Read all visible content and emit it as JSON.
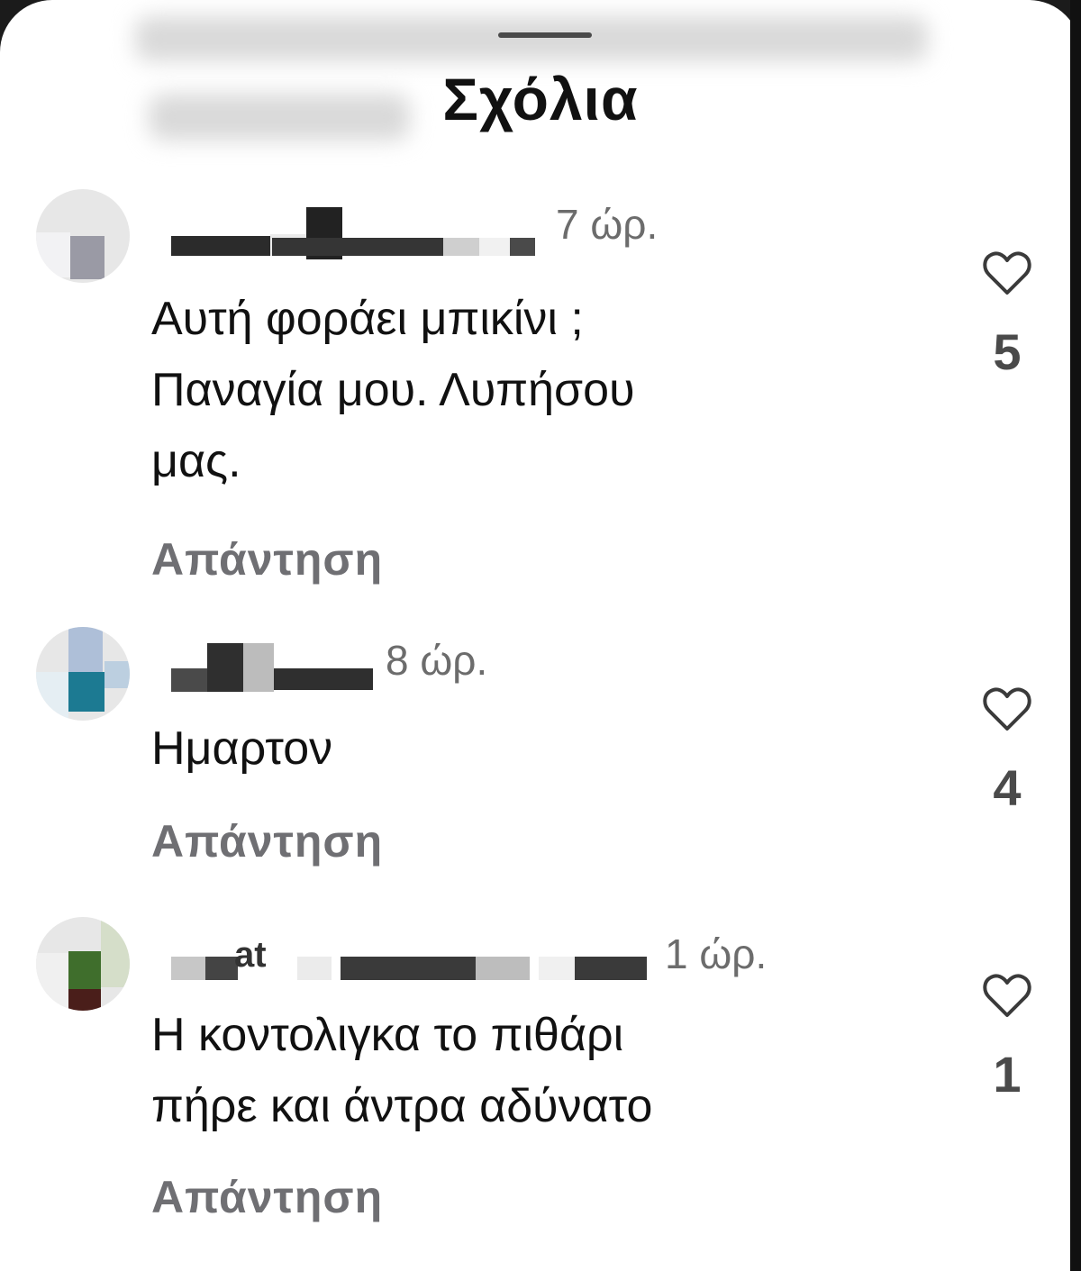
{
  "sheet": {
    "title": "Σχόλια"
  },
  "comments": [
    {
      "time": "7 ώρ.",
      "text": "Αυτή φοράει μπικίνι ;\nΠαναγία μου. Λυπήσου\nμας.",
      "reply_label": "Απάντηση",
      "likes": "5",
      "like_icon": "heart-outline-icon"
    },
    {
      "time": "8 ώρ.",
      "text": "Ημαρτον",
      "reply_label": "Απάντηση",
      "likes": "4",
      "like_icon": "heart-outline-icon"
    },
    {
      "time": "1 ώρ.",
      "username_visible_fragment": "at",
      "text": "Η κοντολιγκα το πιθάρι\nπήρε και άντρα αδύνατο",
      "reply_label": "Απάντηση",
      "likes": "1",
      "like_icon": "heart-outline-icon"
    }
  ],
  "colors": {
    "text": "#111111",
    "secondary": "#6c6c6c",
    "reply": "#6f6f73",
    "like_count": "#4a4a4a"
  }
}
